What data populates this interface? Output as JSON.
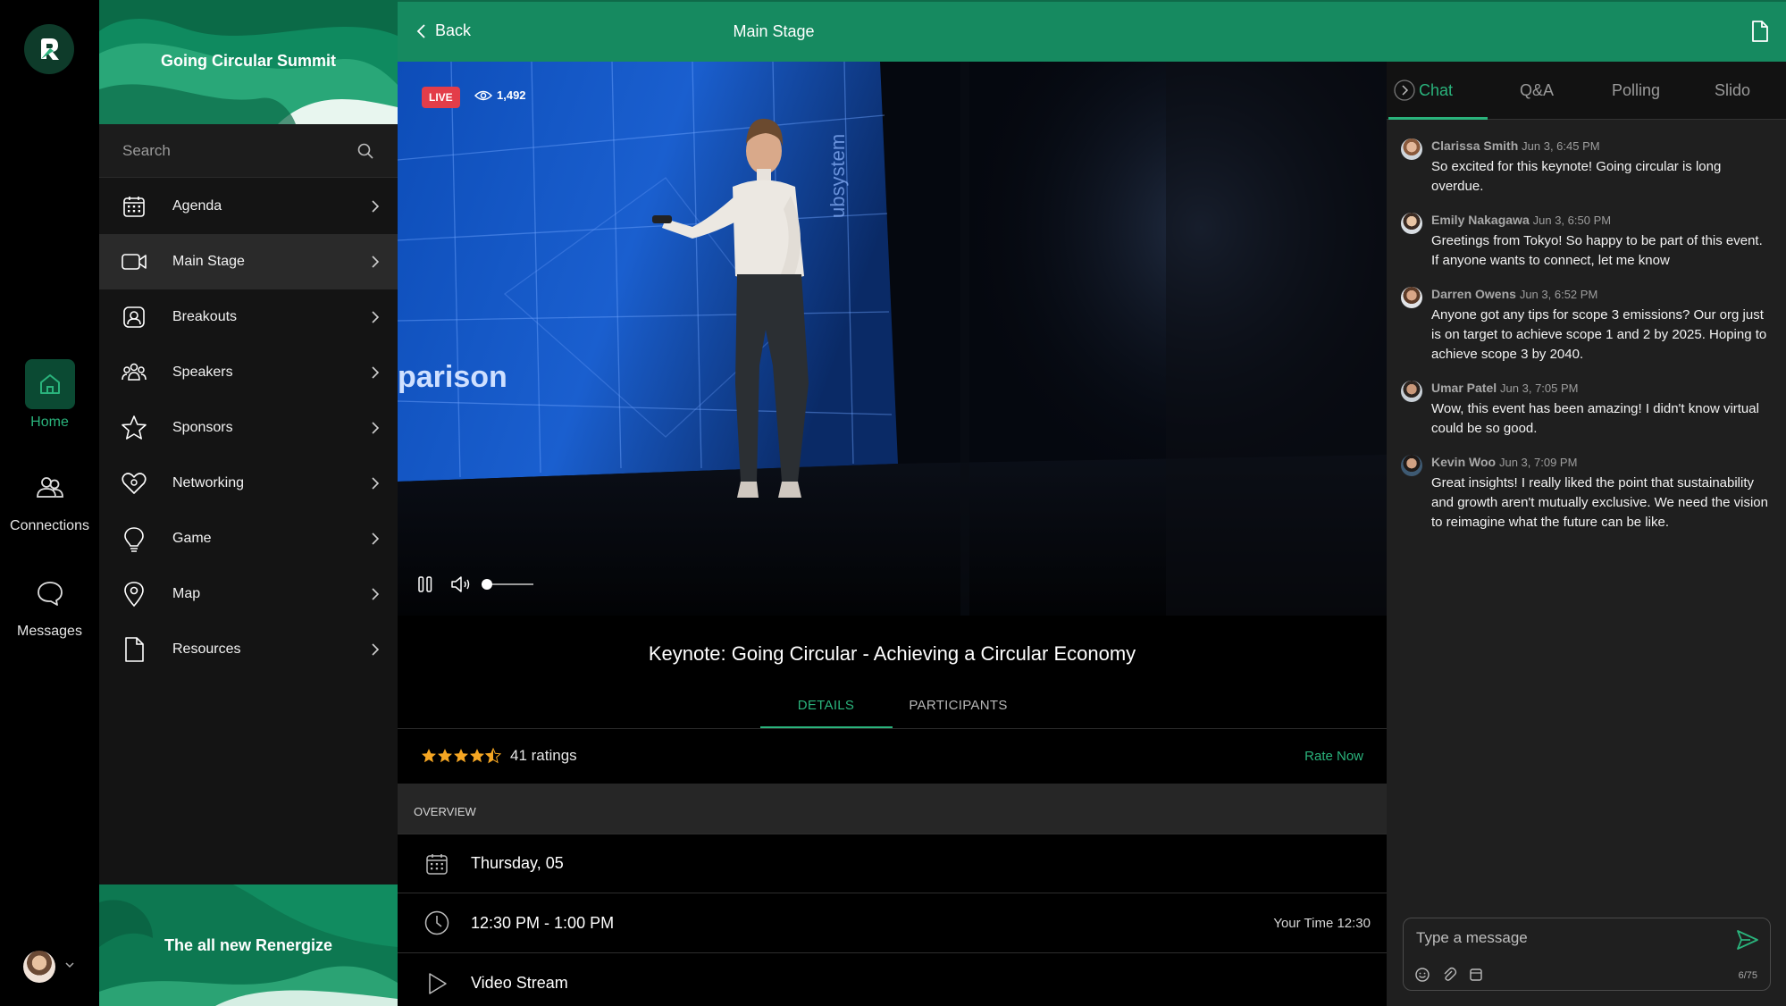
{
  "rail": {
    "items": [
      {
        "label": "Home",
        "icon": "home-icon",
        "active": true
      },
      {
        "label": "Connections",
        "icon": "people-icon"
      },
      {
        "label": "Messages",
        "icon": "chat-bubble-icon"
      }
    ]
  },
  "sidebar": {
    "event_title": "Going Circular Summit",
    "search_placeholder": "Search",
    "items": [
      {
        "label": "Agenda",
        "icon": "calendar-icon"
      },
      {
        "label": "Main Stage",
        "icon": "video-camera-icon",
        "active": true
      },
      {
        "label": "Breakouts",
        "icon": "breakout-room-icon"
      },
      {
        "label": "Speakers",
        "icon": "speakers-group-icon"
      },
      {
        "label": "Sponsors",
        "icon": "star-icon"
      },
      {
        "label": "Networking",
        "icon": "networking-icon"
      },
      {
        "label": "Game",
        "icon": "trophy-icon"
      },
      {
        "label": "Map",
        "icon": "map-pin-icon"
      },
      {
        "label": "Resources",
        "icon": "document-icon"
      }
    ],
    "promo_text": "The all new Renergize"
  },
  "topbar": {
    "back_label": "Back",
    "title": "Main Stage"
  },
  "video": {
    "live_label": "LIVE",
    "viewer_count": "1,492",
    "screen_text": "parison",
    "screen_vertical_text": "ubsystem",
    "volume_level": 0.0
  },
  "details": {
    "title": "Keynote: Going Circular - Achieving a Circular Economy",
    "tabs": [
      "DETAILS",
      "PARTICIPANTS"
    ],
    "active_tab": "DETAILS",
    "rating": 4.5,
    "rating_count": "41 ratings",
    "rate_label": "Rate Now",
    "overview_label": "OVERVIEW",
    "date": "Thursday, 05",
    "time": "12:30 PM - 1:00 PM",
    "your_time": "Your Time 12:30",
    "stream": "Video Stream"
  },
  "chat": {
    "tabs": [
      "Chat",
      "Q&A",
      "Polling",
      "Slido"
    ],
    "active_tab": "Chat",
    "messages": [
      {
        "name": "Clarissa Smith",
        "time": "Jun 3, 6:45 PM",
        "text": "So excited for this keynote! Going circular is long overdue."
      },
      {
        "name": "Emily Nakagawa",
        "time": "Jun 3, 6:50 PM",
        "text": "Greetings from Tokyo! So happy to be part of this event. If anyone wants to connect, let me know"
      },
      {
        "name": "Darren Owens",
        "time": "Jun 3, 6:52 PM",
        "text": "Anyone got any tips for scope 3 emissions? Our org just is on target to achieve scope 1 and 2 by 2025. Hoping to achieve scope 3 by 2040."
      },
      {
        "name": "Umar Patel",
        "time": "Jun 3, 7:05 PM",
        "text": "Wow, this event has been amazing! I didn't know virtual could be so good."
      },
      {
        "name": "Kevin Woo",
        "time": "Jun 3, 7:09 PM",
        "text": "Great insights! I really liked the point that sustainability and growth aren't mutually exclusive. We need the vision to reimagine what the future can be like."
      }
    ],
    "input_placeholder": "Type a message",
    "char_count": "6/75"
  },
  "colors": {
    "accent": "#168a60",
    "accent_text": "#2ab37c",
    "live": "#e33d49",
    "star": "#f5a623"
  }
}
